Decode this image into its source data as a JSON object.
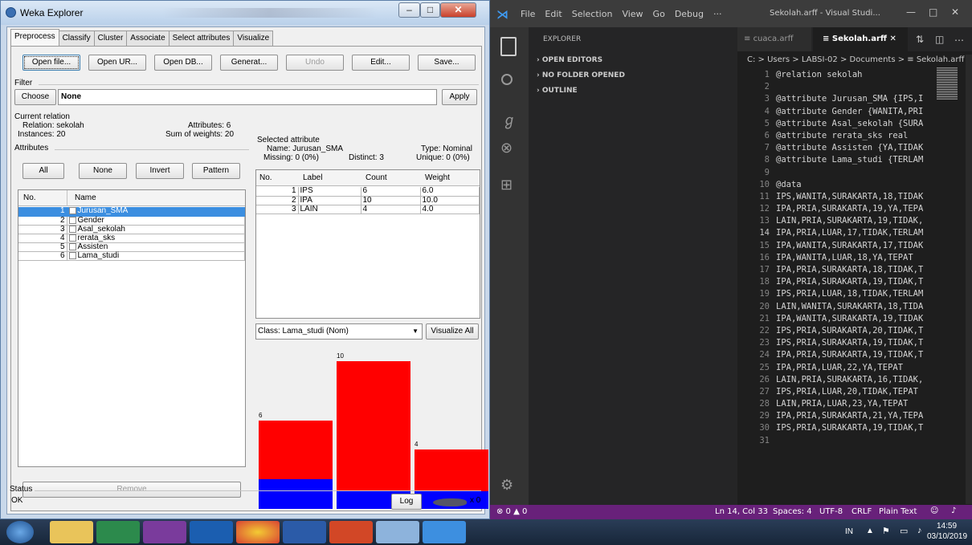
{
  "weka": {
    "title": "Weka Explorer",
    "tabs": [
      "Preprocess",
      "Classify",
      "Cluster",
      "Associate",
      "Select attributes",
      "Visualize"
    ],
    "buttons": {
      "open_file": "Open file...",
      "open_url": "Open UR...",
      "open_db": "Open DB...",
      "generate": "Generat...",
      "undo": "Undo",
      "edit": "Edit...",
      "save": "Save..."
    },
    "filter": {
      "label": "Filter",
      "choose": "Choose",
      "value": "None",
      "apply": "Apply"
    },
    "current_relation": {
      "label": "Current relation",
      "relation": "Relation: sekolah",
      "instances": "Instances: 20",
      "attributes": "Attributes: 6",
      "sum_weights": "Sum of weights: 20"
    },
    "attributes": {
      "label": "Attributes",
      "buttons": [
        "All",
        "None",
        "Invert",
        "Pattern"
      ],
      "col_no": "No.",
      "col_name": "Name",
      "rows": [
        {
          "no": "1",
          "name": "Jurusan_SMA"
        },
        {
          "no": "2",
          "name": "Gender"
        },
        {
          "no": "3",
          "name": "Asal_sekolah"
        },
        {
          "no": "4",
          "name": "rerata_sks"
        },
        {
          "no": "5",
          "name": "Assisten"
        },
        {
          "no": "6",
          "name": "Lama_studi"
        }
      ],
      "remove": "Remove"
    },
    "selected_attribute": {
      "label": "Selected attribute",
      "name": "Name: Jurusan_SMA",
      "type": "Type: Nominal",
      "missing": "Missing: 0 (0%)",
      "distinct": "Distinct: 3",
      "unique": "Unique: 0 (0%)",
      "headers": [
        "No.",
        "Label",
        "Count",
        "Weight"
      ],
      "rows": [
        {
          "no": "1",
          "label": "IPS",
          "count": "6",
          "weight": "6.0"
        },
        {
          "no": "2",
          "label": "IPA",
          "count": "10",
          "weight": "10.0"
        },
        {
          "no": "3",
          "label": "LAIN",
          "count": "4",
          "weight": "4.0"
        }
      ]
    },
    "class_select": "Class: Lama_studi (Nom)",
    "visualize_all": "Visualize All",
    "histogram": {
      "bars": [
        {
          "label": "6",
          "total": 6,
          "blue": 2
        },
        {
          "label": "10",
          "total": 10,
          "blue": 1.2
        },
        {
          "label": "4",
          "total": 4,
          "blue": 1.2
        }
      ],
      "colors": {
        "top": "#ff0000",
        "bottom": "#0000ff"
      }
    },
    "status": {
      "label": "Status",
      "text": "OK",
      "log": "Log",
      "count": "x 0"
    }
  },
  "vscode": {
    "menu": [
      "File",
      "Edit",
      "Selection",
      "View",
      "Go",
      "Debug",
      "···"
    ],
    "window_title": "Sekolah.arff - Visual Studi...",
    "explorer_title": "EXPLORER",
    "sections": [
      "OPEN EDITORS",
      "NO FOLDER OPENED",
      "OUTLINE"
    ],
    "tabs": [
      {
        "label": "cuaca.arff"
      },
      {
        "label": "Sekolah.arff"
      }
    ],
    "breadcrumb": "C: > Users > LABSI-02 > Documents > ≡ Sekolah.arff",
    "lines": [
      "@relation sekolah",
      "",
      "@attribute Jurusan_SMA {IPS,I",
      "@attribute Gender {WANITA,PRI",
      "@attribute Asal_sekolah {SURA",
      "@attribute rerata_sks real",
      "@attribute Assisten {YA,TIDAK",
      "@attribute Lama_studi {TERLAM",
      "",
      "@data",
      "IPS,WANITA,SURAKARTA,18,TIDAK",
      "IPA,PRIA,SURAKARTA,19,YA,TEPA",
      "LAIN,PRIA,SURAKARTA,19,TIDAK,",
      "IPA,PRIA,LUAR,17,TIDAK,TERLAM",
      "IPA,WANITA,SURAKARTA,17,TIDAK",
      "IPA,WANITA,LUAR,18,YA,TEPAT",
      "IPA,PRIA,SURAKARTA,18,TIDAK,T",
      "IPA,PRIA,SURAKARTA,19,TIDAK,T",
      "IPS,PRIA,LUAR,18,TIDAK,TERLAM",
      "LAIN,WANITA,SURAKARTA,18,TIDA",
      "IPA,WANITA,SURAKARTA,19,TIDAK",
      "IPS,PRIA,SURAKARTA,20,TIDAK,T",
      "IPS,PRIA,SURAKARTA,19,TIDAK,T",
      "IPA,PRIA,SURAKARTA,19,TIDAK,T",
      "IPA,PRIA,LUAR,22,YA,TEPAT",
      "LAIN,PRIA,SURAKARTA,16,TIDAK,",
      "IPS,PRIA,LUAR,20,TIDAK,TEPAT",
      "LAIN,PRIA,LUAR,23,YA,TEPAT",
      "IPA,PRIA,SURAKARTA,21,YA,TEPA",
      "IPS,PRIA,SURAKARTA,19,TIDAK,T",
      ""
    ],
    "status": {
      "problems": "⊗ 0 ▲ 0",
      "position": "Ln 14, Col 33",
      "spaces": "Spaces: 4",
      "encoding": "UTF-8",
      "eol": "CRLF",
      "language": "Plain Text"
    },
    "accent": "#68217a"
  },
  "taskbar": {
    "lang": "IN",
    "time": "14:59",
    "date": "03/10/2019"
  }
}
